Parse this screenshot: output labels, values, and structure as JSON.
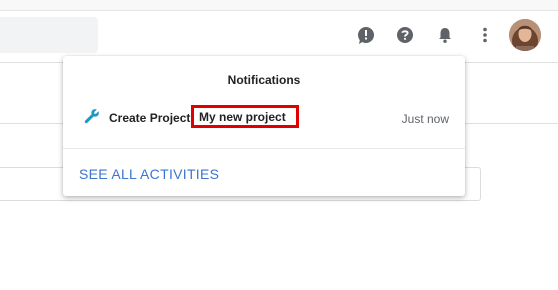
{
  "header": {
    "icons": [
      "feedback-icon",
      "help-icon",
      "notifications-icon",
      "more-vert-icon",
      "avatar"
    ]
  },
  "notifications": {
    "title": "Notifications",
    "items": [
      {
        "icon": "wrench-icon",
        "action": "Create Project",
        "project": "My new project",
        "time": "Just now"
      }
    ],
    "see_all_label": "SEE ALL ACTIVITIES"
  },
  "colors": {
    "accent": "#3a75d0",
    "highlight_border": "#e00000",
    "icon": "#5f6368",
    "wrench": "#1a9bc4"
  }
}
